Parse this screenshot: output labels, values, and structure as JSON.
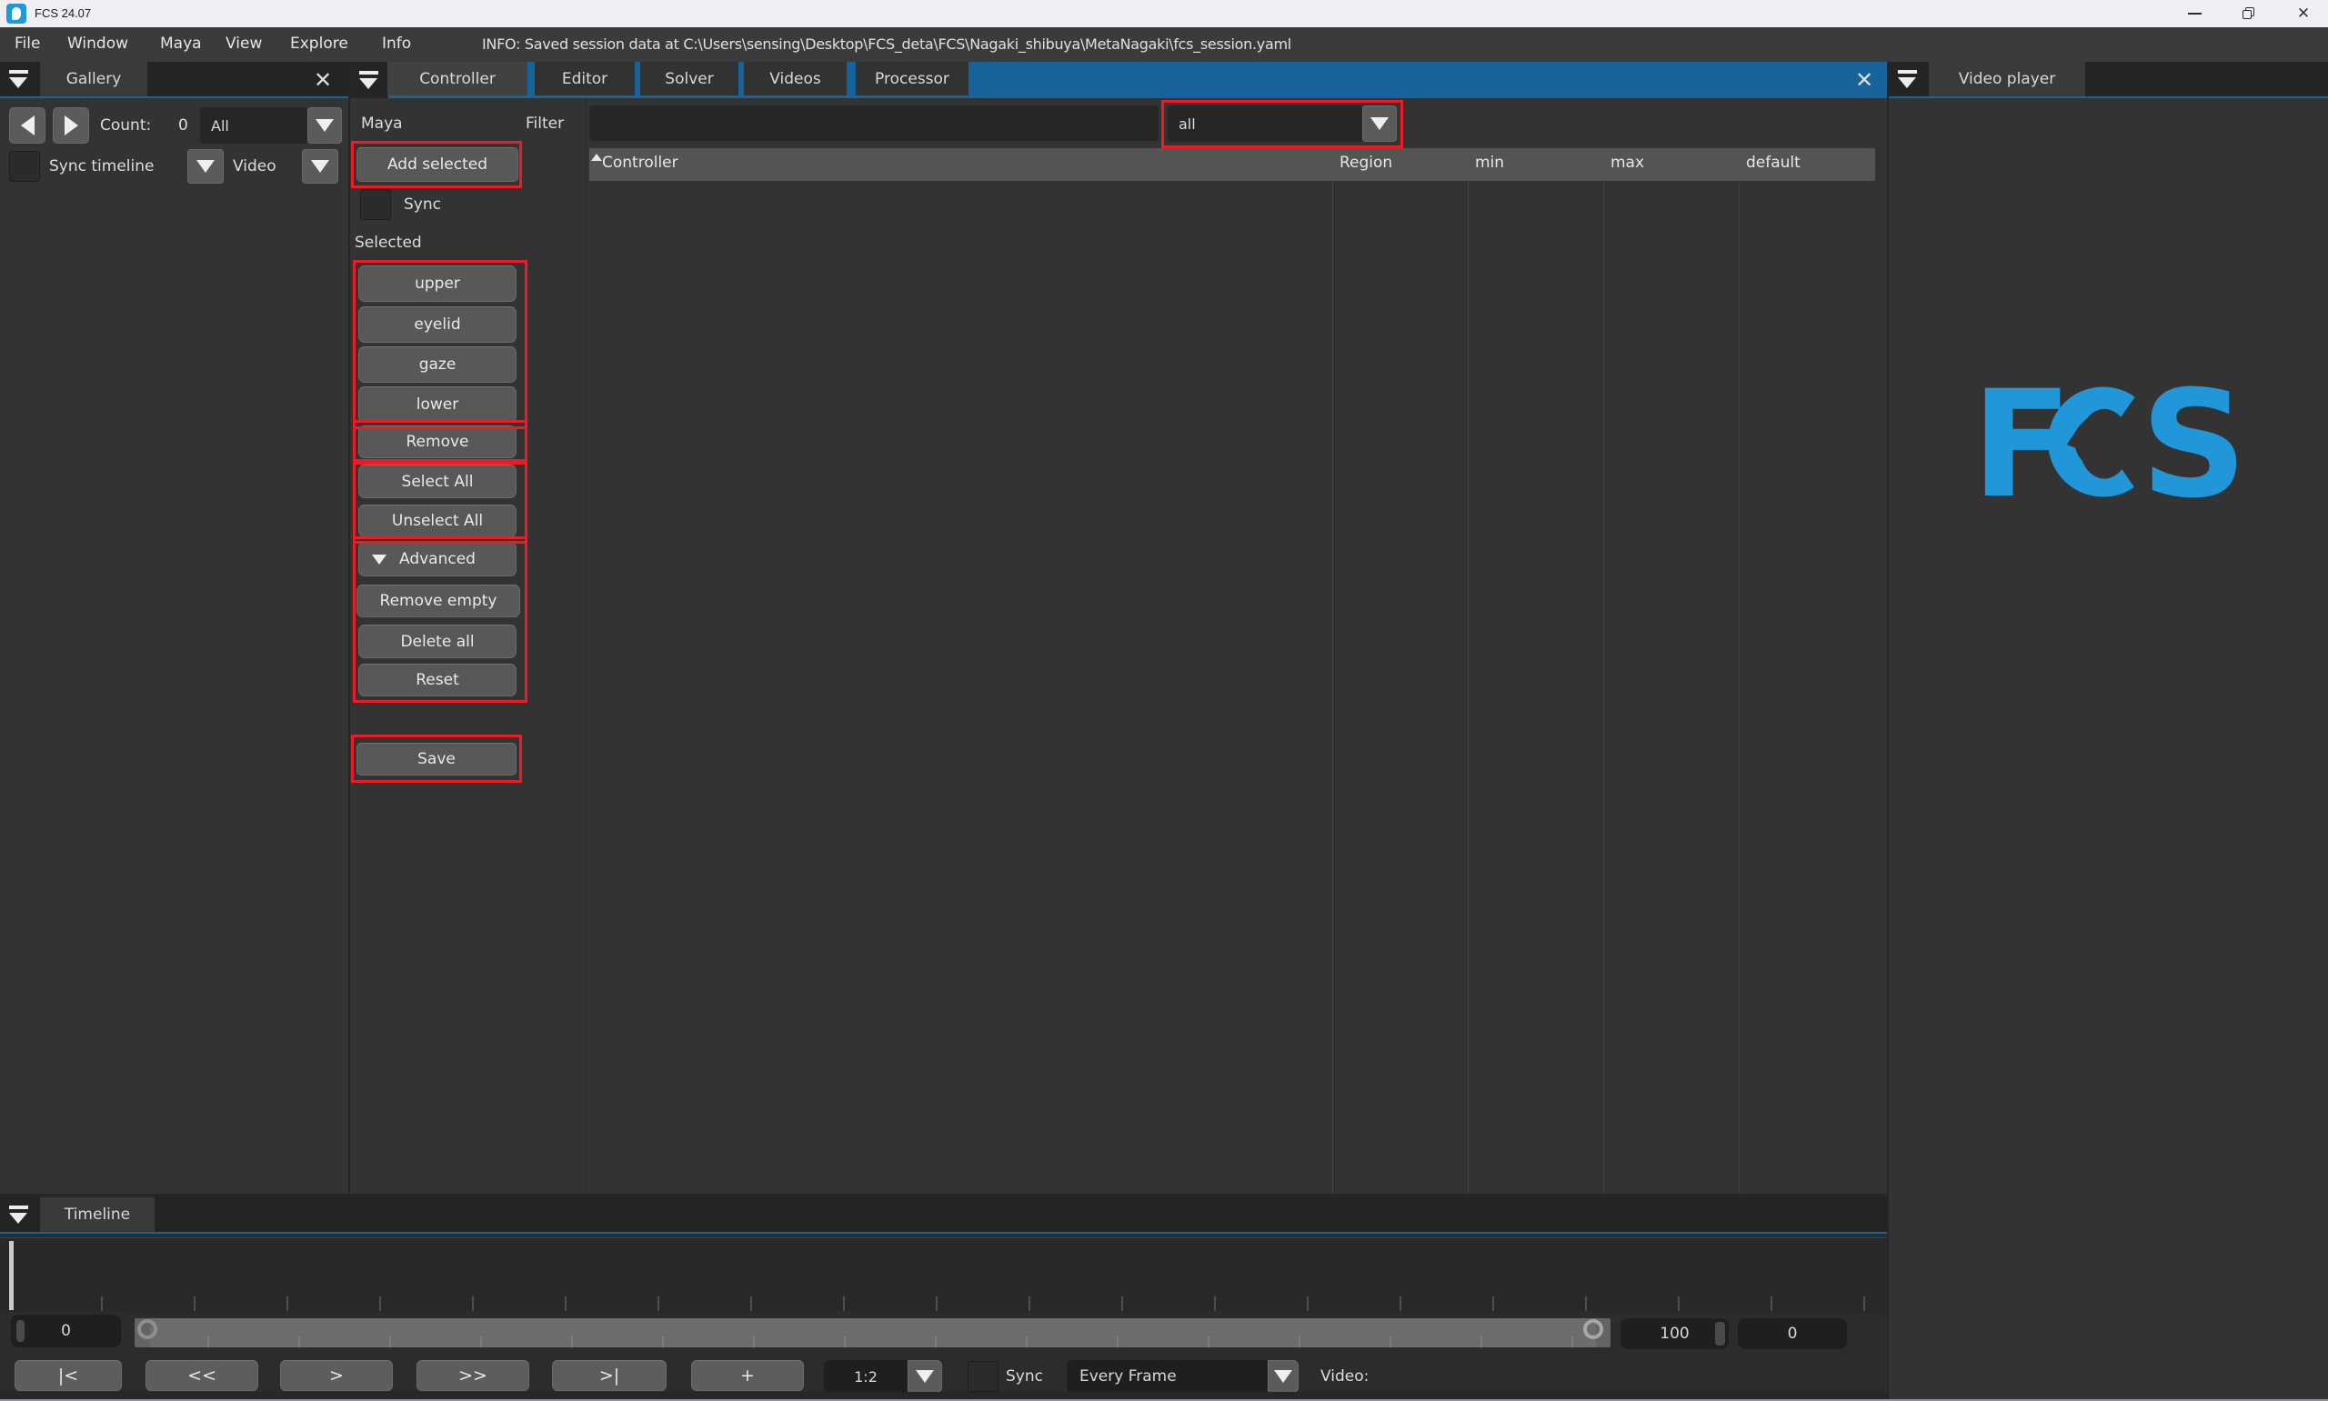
{
  "window": {
    "title": "FCS 24.07",
    "minimize_glyph": "–",
    "close_glyph": "✕"
  },
  "menubar": {
    "items": [
      "File",
      "Window",
      "Maya",
      "View",
      "Explore",
      "Info"
    ],
    "status": "INFO: Saved session data at C:\\Users\\sensing\\Desktop\\FCS_deta\\FCS\\Nagaki_shibuya\\MetaNagaki\\fcs_session.yaml"
  },
  "gallery": {
    "title": "Gallery",
    "close_glyph": "✕",
    "count_label": "Count:",
    "count_value": "0",
    "range_value": "All",
    "sync_timeline_label": "Sync timeline",
    "video_label": "Video"
  },
  "controller": {
    "tabs": [
      "Controller",
      "Editor",
      "Solver",
      "Videos",
      "Processor"
    ],
    "close_glyph": "✕",
    "maya_label": "Maya",
    "filter_label": "Filter",
    "filter_value": "",
    "region_filter_value": "all",
    "add_selected_label": "Add selected",
    "sync_label": "Sync",
    "selected_label": "Selected",
    "region_buttons": [
      "upper",
      "eyelid",
      "gaze",
      "lower"
    ],
    "remove_label": "Remove",
    "select_all_label": "Select All",
    "unselect_all_label": "Unselect All",
    "advanced_label": "Advanced",
    "remove_empty_label": "Remove empty",
    "delete_all_label": "Delete all",
    "reset_label": "Reset",
    "save_label": "Save",
    "table": {
      "columns": [
        "Controller",
        "Region",
        "min",
        "max",
        "default"
      ],
      "rows": []
    }
  },
  "video_player": {
    "title": "Video player",
    "logo_f": "F",
    "logo_s": "S"
  },
  "timeline": {
    "title": "Timeline",
    "current_value": "0",
    "range_end_value": "100",
    "offset_value": "0",
    "transport": [
      "|<",
      "<<",
      ">",
      ">>",
      ">|",
      "+"
    ],
    "step_value": "1:2",
    "sync_label": "Sync",
    "playback_mode_value": "Every Frame",
    "video_label": "Video:"
  },
  "colors": {
    "accent_blue": "#17639b",
    "annotation_red": "#ea1c24",
    "logo_blue": "#2196d8"
  }
}
